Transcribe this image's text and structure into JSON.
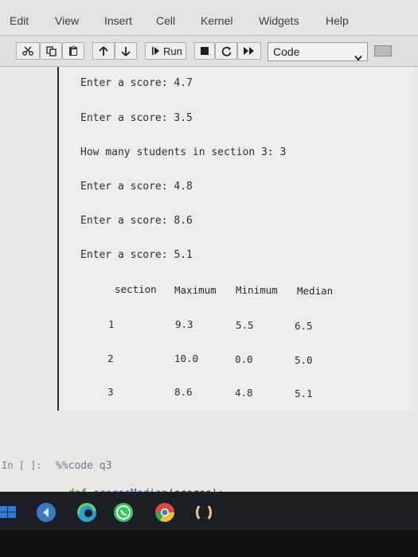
{
  "menu": {
    "items": [
      "Edit",
      "View",
      "Insert",
      "Cell",
      "Kernel",
      "Widgets",
      "Help"
    ]
  },
  "toolbar": {
    "run_label": "Run",
    "cell_type": "Code",
    "icons": [
      "cut-icon",
      "copy-icon",
      "paste-icon",
      "move-up-icon",
      "move-down-icon",
      "run-icon",
      "stop-icon",
      "restart-icon",
      "fast-forward-icon",
      "keyboard-icon"
    ]
  },
  "output": {
    "lines": [
      "Enter a score: 4.7",
      "Enter a score: 3.5",
      "How many students in section 3: 3",
      "Enter a score: 4.8",
      "Enter a score: 8.6",
      "Enter a score: 5.1"
    ],
    "table": {
      "headers": [
        "section",
        "Maximum",
        "Minimum",
        "Median"
      ],
      "rows": [
        [
          "1",
          "9.3",
          "5.5",
          "6.5"
        ],
        [
          "2",
          "10.0",
          "0.0",
          "5.0"
        ],
        [
          "3",
          "8.6",
          "4.8",
          "5.1"
        ]
      ]
    }
  },
  "next_cell": {
    "prompt": "In [ ]:",
    "line1_magic": "%%code q3",
    "line2_kw": "def",
    "line2_fn": "scoresMedian",
    "line2_rest": "(scores):",
    "line3": "..."
  },
  "taskbar": {
    "icons": [
      "windows-icon",
      "media-icon",
      "edge-icon",
      "whatsapp-icon",
      "chrome-icon",
      "app-icon"
    ],
    "colors": {
      "bar": "#1b1e23",
      "accent": "#2b7de0"
    }
  }
}
